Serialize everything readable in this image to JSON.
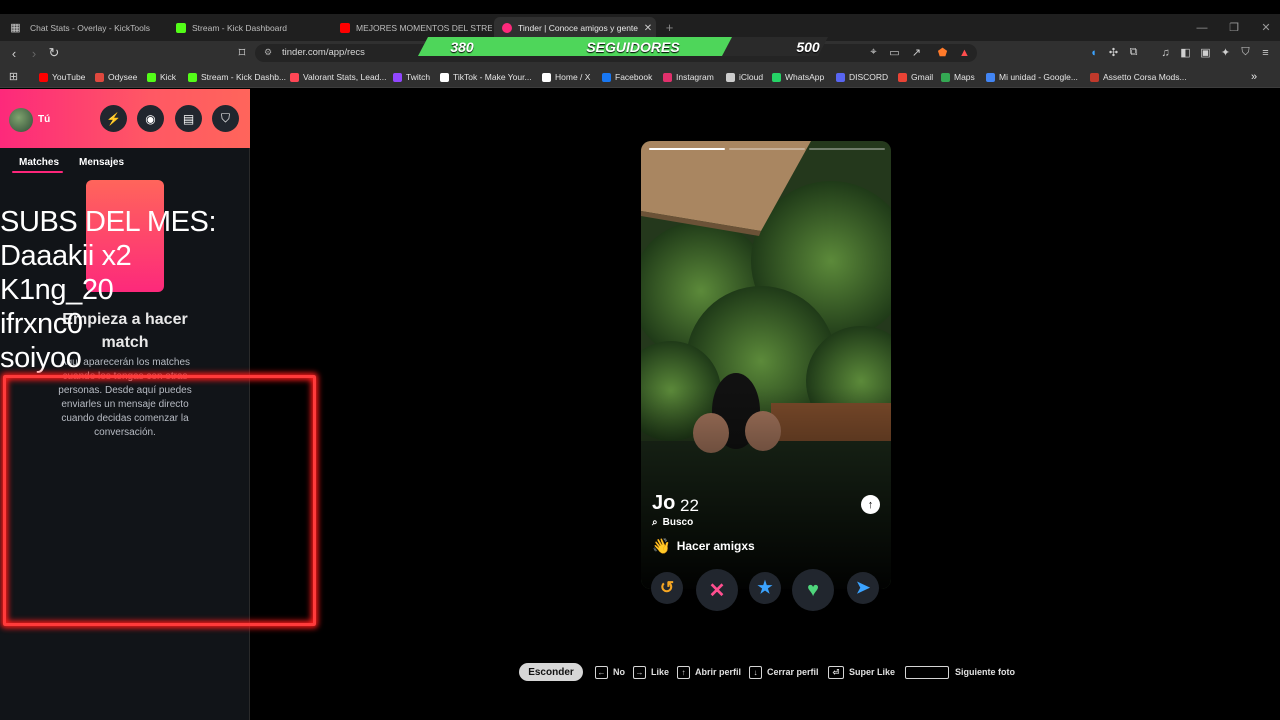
{
  "browser": {
    "tabs": [
      {
        "title": "Chat Stats - Overlay - KickTools",
        "icon": "grid-icon"
      },
      {
        "title": "Stream - Kick Dashboard",
        "icon": "kick-icon"
      },
      {
        "title": "MEJORES MOMENTOS DEL STREAM",
        "icon": "youtube-icon"
      },
      {
        "title": "Tinder | Conoce amigos y gente",
        "icon": "tinder-icon"
      }
    ],
    "url": "tinder.com/app/recs",
    "bookmarks": [
      "YouTube",
      "Odysee",
      "Kick",
      "Stream - Kick Dashb...",
      "Valorant Stats, Lead...",
      "Twitch",
      "TikTok - Make Your...",
      "Home / X",
      "Facebook",
      "Instagram",
      "iCloud",
      "WhatsApp",
      "DISCORD",
      "Gmail",
      "Maps",
      "Mi unidad - Google...",
      "Assetto Corsa Mods..."
    ],
    "bookmark_overflow": "»"
  },
  "overlay": {
    "followers_current": "380",
    "followers_label": "SEGUIDORES",
    "followers_goal": "500",
    "followers_progress": 0.76,
    "subs": [
      "SUBS DEL MES:",
      "Daaakii x2",
      "K1ng_20",
      "ifrxnc0",
      "soiyoo"
    ]
  },
  "sidebar": {
    "user_label": "Tú",
    "tabs": [
      "Matches",
      "Mensajes"
    ],
    "empty_title": "Empieza a hacer match",
    "empty_desc": "Aquí aparecerán los matches cuando los tengas con otras personas. Desde aquí puedes enviarles un mensaje directo cuando decidas comenzar la conversación."
  },
  "profile": {
    "name": "Jo",
    "age": "22",
    "looking_label": "Busco",
    "interest_emoji": "👋",
    "interest": "Hacer amigxs",
    "photo_count": 3,
    "photo_active": 1
  },
  "actions": [
    {
      "name": "rewind-button",
      "glyph": "↺",
      "color": "#f5a623"
    },
    {
      "name": "nope-button",
      "glyph": "✕",
      "color": "#ff4f8f"
    },
    {
      "name": "super-like-button",
      "glyph": "★",
      "color": "#3ba3ff"
    },
    {
      "name": "like-button",
      "glyph": "♥",
      "color": "#4fd67c"
    },
    {
      "name": "boost-button",
      "glyph": "➤",
      "color": "#3ba3ff"
    }
  ],
  "shortcuts": {
    "hide": "Esconder",
    "items": [
      {
        "key": "←",
        "label": "No"
      },
      {
        "key": "→",
        "label": "Like"
      },
      {
        "key": "↑",
        "label": "Abrir perfil"
      },
      {
        "key": "↓",
        "label": "Cerrar perfil"
      },
      {
        "key": "⏎",
        "label": "Super Like"
      },
      {
        "key": "",
        "label": "Siguiente foto"
      }
    ]
  },
  "colors": {
    "brand": "#fd297b",
    "accent": "#ff655b",
    "green_bar": "#4ed65a"
  }
}
